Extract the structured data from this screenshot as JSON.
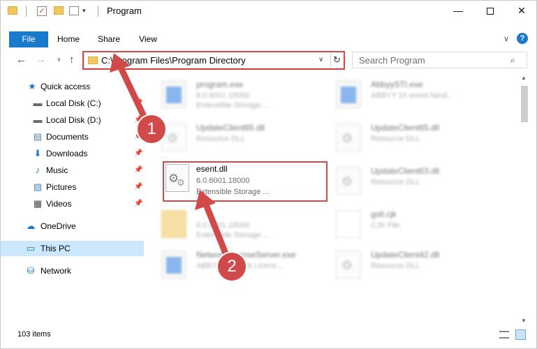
{
  "titlebar": {
    "title": "Program",
    "dropdown": "▾",
    "minimize": "—",
    "close": "✕"
  },
  "ribbon": {
    "tabs": [
      "File",
      "Home",
      "Share",
      "View"
    ],
    "chevron": "∨",
    "help": "?"
  },
  "nav": {
    "back": "←",
    "forward": "→",
    "recent": "∨",
    "up": "↑",
    "address": "C:\\Program Files\\Program Directory",
    "address_dropdown": "∨",
    "refresh": "↻",
    "search_placeholder": "Search Program",
    "search_icon": "⌕"
  },
  "sidebar": {
    "items": [
      {
        "label": "Quick access",
        "icon": "★",
        "icon_color": "#1979ca",
        "pinned": false
      },
      {
        "label": "Local Disk (C:)",
        "icon": "▬",
        "icon_color": "#6b6b6b",
        "pinned": true
      },
      {
        "label": "Local Disk (D:)",
        "icon": "▬",
        "icon_color": "#6b6b6b",
        "pinned": true
      },
      {
        "label": "Documents",
        "icon": "▤",
        "icon_color": "#5c7fa8",
        "pinned": true
      },
      {
        "label": "Downloads",
        "icon": "⬇",
        "icon_color": "#1979ca",
        "pinned": true
      },
      {
        "label": "Music",
        "icon": "♪",
        "icon_color": "#1979ca",
        "pinned": true
      },
      {
        "label": "Pictures",
        "icon": "▨",
        "icon_color": "#4a8cc9",
        "pinned": true
      },
      {
        "label": "Videos",
        "icon": "▦",
        "icon_color": "#444444",
        "pinned": true
      },
      {
        "label": "OneDrive",
        "icon": "☁",
        "icon_color": "#1979ca",
        "pinned": false
      },
      {
        "label": "This PC",
        "icon": "▭",
        "icon_color": "#1979ca",
        "pinned": false
      },
      {
        "label": "Network",
        "icon": "⛁",
        "icon_color": "#1979ca",
        "pinned": false
      }
    ],
    "pin_glyph": "📌"
  },
  "files": [
    {
      "name": "program.exe",
      "line2": "6.0.6001.18000",
      "line3": "Extensible Storage ...",
      "kind": "exe"
    },
    {
      "name": "AbbyySTI.exe",
      "line2": "ABBYY 15 event hand...",
      "line3": "",
      "kind": "exe"
    },
    {
      "name": "UpdateClient65.dll",
      "line2": "Resource DLL",
      "line3": "",
      "kind": "dll"
    },
    {
      "name": "UpdateClient65.dll",
      "line2": "Resource DLL",
      "line3": "",
      "kind": "dll"
    },
    {
      "name": "UpdateClient63.dll",
      "line2": "Resource DLL",
      "line3": "",
      "kind": "dll"
    },
    {
      "name": "",
      "line2": "6.0.6001.18000",
      "line3": "Extensible Storage ...",
      "kind": "folder"
    },
    {
      "name": "gstl.cjk",
      "line2": "CJK File",
      "line3": "",
      "kind": "file"
    },
    {
      "name": "NetworkLicenseServer.exe",
      "line2": "ABBYY Network Licens...",
      "line3": "",
      "kind": "exe"
    },
    {
      "name": "UpdateClient42.dll",
      "line2": "Resource DLL",
      "line3": "",
      "kind": "dll"
    }
  ],
  "highlighted_file": {
    "name": "esent.dll",
    "version": "6.0.6001.18000",
    "description": "Extensible Storage ..."
  },
  "status": {
    "item_count": "103 items"
  },
  "annotations": {
    "badge_1": "1",
    "badge_2": "2",
    "color": "#d14a4a"
  },
  "colors": {
    "accent": "#1979ca",
    "selection": "#cce8ff"
  }
}
